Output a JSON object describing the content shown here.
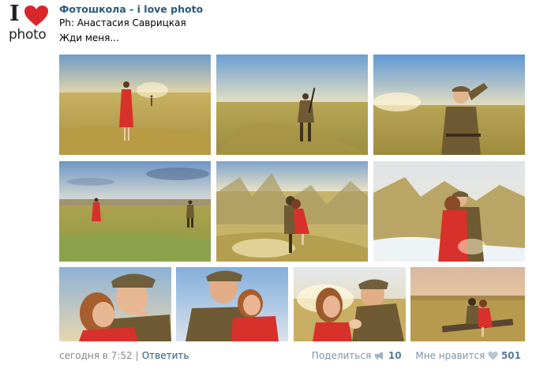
{
  "avatar": {
    "letter": "I",
    "word": "photo"
  },
  "post": {
    "author": "Фотошкола - i love photo",
    "credit": "Ph: Анастасия Саврицкая",
    "caption": "Жди меня..."
  },
  "photos": [
    {
      "id": "photo-1",
      "scene": "woman-red-dress-field"
    },
    {
      "id": "photo-2",
      "scene": "soldier-with-rifle"
    },
    {
      "id": "photo-3",
      "scene": "soldier-saluting"
    },
    {
      "id": "photo-4",
      "scene": "woman-and-soldier-distance"
    },
    {
      "id": "photo-5",
      "scene": "embrace-in-grass"
    },
    {
      "id": "photo-6",
      "scene": "embrace-by-river"
    },
    {
      "id": "photo-7",
      "scene": "closeup-embrace"
    },
    {
      "id": "photo-8",
      "scene": "smiling-couple"
    },
    {
      "id": "photo-9",
      "scene": "holding-hands"
    },
    {
      "id": "photo-10",
      "scene": "sitting-on-log"
    }
  ],
  "footer": {
    "time": "сегодня в 7:52",
    "separator": "|",
    "reply": "Ответить",
    "share": "Поделиться",
    "share_count": "10",
    "like": "Мне нравится",
    "like_count": "501"
  },
  "colors": {
    "link": "#2b587a",
    "muted": "#888888",
    "heart": "#d8262b",
    "dress": "#d8312b",
    "uniform": "#6e5a33"
  }
}
